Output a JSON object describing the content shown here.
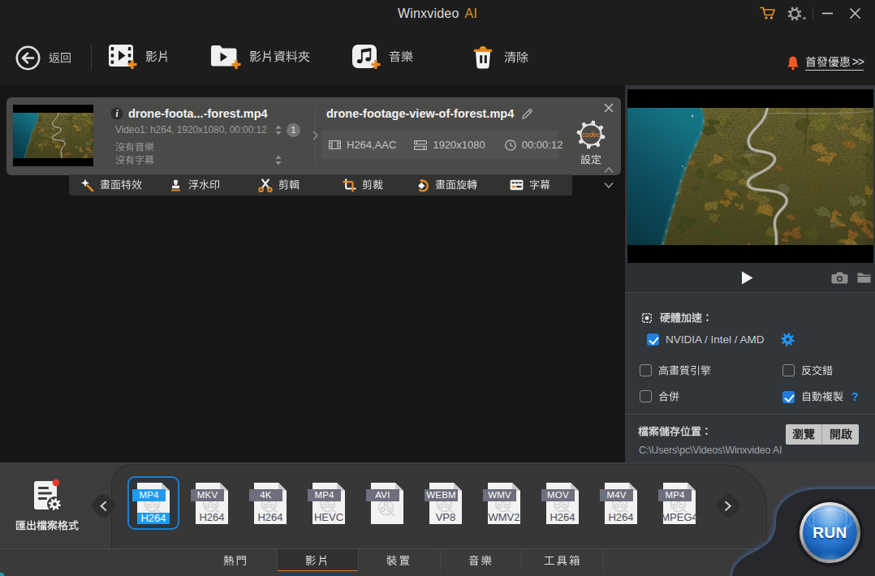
{
  "window": {
    "title": "Winxvideo",
    "title_accent": "AI"
  },
  "toolbar": {
    "back": "返回",
    "add_video": "影片",
    "add_video_folder": "影片資料夾",
    "add_music": "音樂",
    "clear": "清除",
    "promo": "首發優惠",
    "promo_arrows": ">>"
  },
  "file_entry": {
    "display_name": "drone-foota...-forest.mp4",
    "video_info": "Video1: h264, 1920x1080, 00:00:12",
    "track_badge": "1",
    "audio_status": "沒有音樂",
    "subtitle_status": "沒有字幕",
    "output_name": "drone-footage-view-of-forest.mp4",
    "codec_chip": "H264,AAC",
    "resolution_chip": "1920x1080",
    "duration_chip": "00:00:12",
    "codec_gear": "codec",
    "settings_label": "設定"
  },
  "edit_tools": [
    {
      "icon": "effects-icon",
      "label": "畫面特效"
    },
    {
      "icon": "watermark-icon",
      "label": "浮水印"
    },
    {
      "icon": "trim-icon",
      "label": "剪輯"
    },
    {
      "icon": "crop-icon",
      "label": "剪裁"
    },
    {
      "icon": "rotate-icon",
      "label": "畫面旋轉"
    },
    {
      "icon": "subtitle-icon",
      "label": "字幕"
    }
  ],
  "acceleration": {
    "title": "硬體加速：",
    "gpu_label": "NVIDIA / Intel / AMD",
    "gpu_checked": true,
    "options": [
      {
        "label": "高畫質引擎",
        "checked": false
      },
      {
        "label": "反交錯",
        "checked": false
      },
      {
        "label": "合併",
        "checked": false
      },
      {
        "label": "自動複製",
        "checked": true,
        "help": "?"
      }
    ]
  },
  "storage": {
    "label": "檔案儲存位置：",
    "browse": "瀏覽",
    "open": "開啟",
    "path": "C:\\Users\\pc\\Videos\\Winxvideo AI"
  },
  "formats": {
    "export_label": "匯出檔案格式",
    "cards": [
      {
        "container": "MP4",
        "codec": "H264",
        "selected": true
      },
      {
        "container": "MKV",
        "codec": "H264",
        "selected": false
      },
      {
        "container": "4K",
        "codec": "H264",
        "selected": false
      },
      {
        "container": "MP4",
        "codec": "HEVC",
        "selected": false
      },
      {
        "container": "AVI",
        "codec": "",
        "selected": false
      },
      {
        "container": "WEBM",
        "codec": "VP8",
        "selected": false
      },
      {
        "container": "WMV",
        "codec": "WMV2",
        "selected": false
      },
      {
        "container": "MOV",
        "codec": "H264",
        "selected": false
      },
      {
        "container": "M4V",
        "codec": "H264",
        "selected": false
      },
      {
        "container": "MP4",
        "codec": "MPEG4",
        "selected": false
      }
    ]
  },
  "tabs": [
    {
      "label": "熱門",
      "active": false
    },
    {
      "label": "影片",
      "active": true
    },
    {
      "label": "裝置",
      "active": false
    },
    {
      "label": "音樂",
      "active": false
    },
    {
      "label": "工具箱",
      "active": false
    }
  ],
  "run": {
    "label": "RUN"
  },
  "icons": [
    "cart-icon",
    "gear-icon",
    "minimize-icon",
    "close-icon",
    "back-icon",
    "video-add-icon",
    "video-folder-add-icon",
    "music-add-icon",
    "trash-icon",
    "bell-icon",
    "info-icon",
    "film-icon",
    "resolution-icon",
    "clock-icon",
    "codec-gear-icon",
    "rename-pencil-icon",
    "effects-icon",
    "watermark-icon",
    "trim-icon",
    "crop-icon",
    "rotate-icon",
    "subtitle-icon",
    "play-button",
    "snapshot-camera-icon",
    "open-folder-icon",
    "cpu-chip-icon",
    "gpu-settings-gear-icon",
    "export-doc-icon",
    "chevron-left-icon",
    "chevron-right-icon",
    "film-reel-watermark-icon"
  ],
  "colors": {
    "accent_orange": "#e8891e",
    "accent_blue": "#1e9af0",
    "checkbox_blue": "#1d7fe0",
    "titlebar_bg": "#1d1d1d",
    "card_bg": "#4a4a49",
    "panel_bg": "#32363a"
  }
}
